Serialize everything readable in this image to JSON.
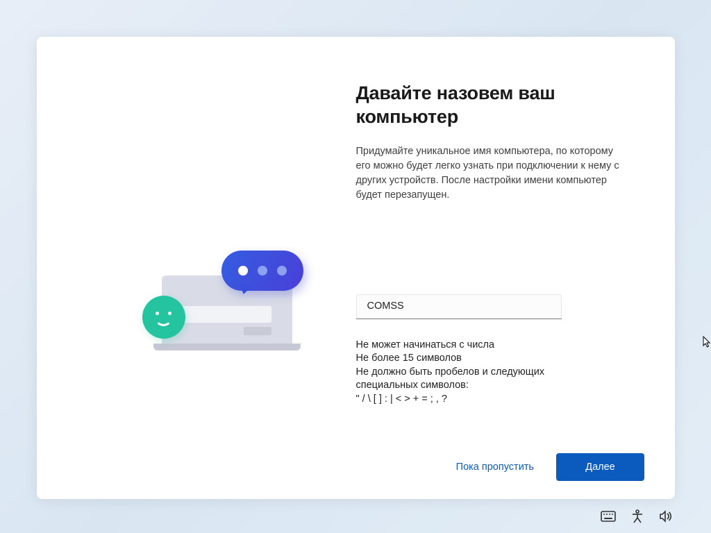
{
  "heading": "Давайте назовем ваш компьютер",
  "subtext": "Придумайте уникальное имя компьютера, по которому его можно будет легко узнать при подключении к нему с других устройств. После настройки имени компьютер будет перезапущен.",
  "name_value": "COMSS",
  "rules": {
    "line1": "Не может начинаться с числа",
    "line2": "Не более 15 символов",
    "line3": "Не должно быть пробелов и следующих специальных символов:",
    "line4": "\" / \\ [ ] : | < > + = ; , ?"
  },
  "buttons": {
    "skip": "Пока пропустить",
    "next": "Далее"
  }
}
